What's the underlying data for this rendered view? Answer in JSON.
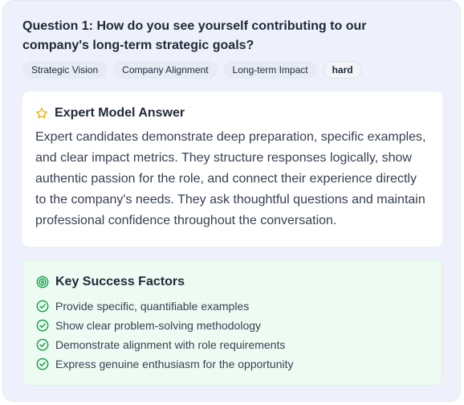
{
  "question": {
    "text": "Question 1: How do you see yourself contributing to our company's long-term strategic goals?"
  },
  "tags": [
    "Strategic Vision",
    "Company Alignment",
    "Long-term Impact"
  ],
  "difficulty": "hard",
  "expert_answer": {
    "title": "Expert Model Answer",
    "icon": "star-icon",
    "text": "Expert candidates demonstrate deep preparation, specific examples, and clear impact metrics. They structure responses logically, show authentic passion for the role, and connect their experience directly to the company's needs. They ask thoughtful questions and maintain professional confidence throughout the conversation."
  },
  "success_factors": {
    "title": "Key Success Factors",
    "icon": "target-icon",
    "items": [
      "Provide specific, quantifiable examples",
      "Show clear problem-solving methodology",
      "Demonstrate alignment with role requirements",
      "Express genuine enthusiasm for the opportunity"
    ]
  },
  "colors": {
    "star": "#eab308",
    "success_green": "#16a34a"
  }
}
